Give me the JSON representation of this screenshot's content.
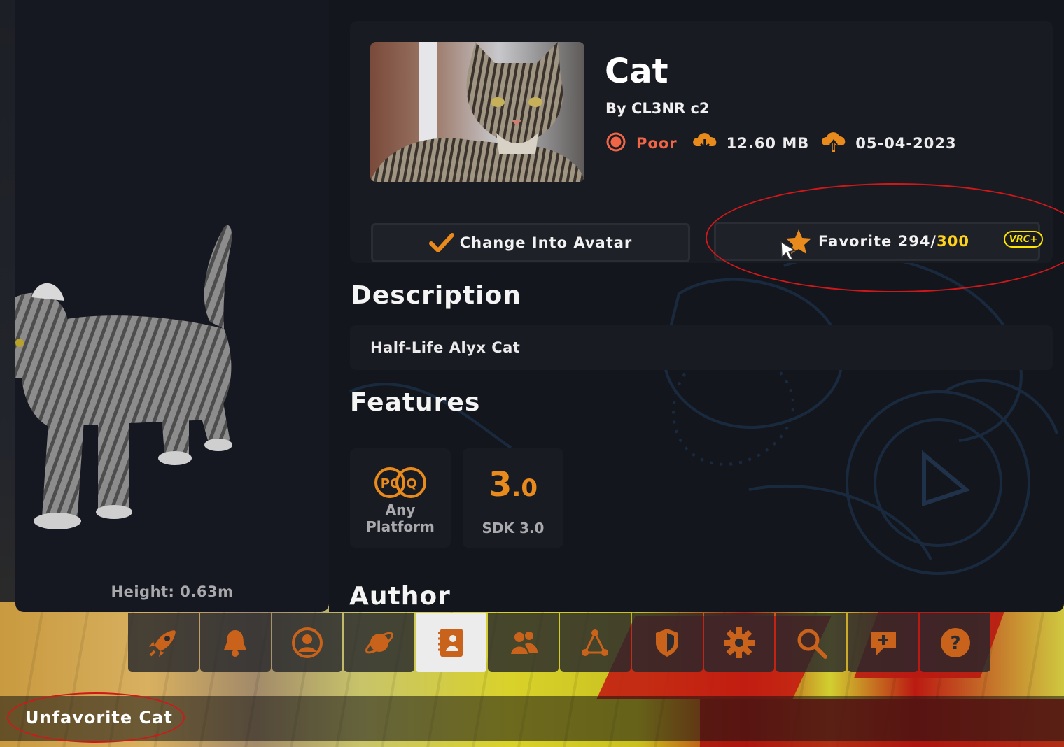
{
  "avatar": {
    "name": "Cat",
    "byline": "By CL3NR c2",
    "performance": "Poor",
    "download_size": "12.60 MB",
    "upload_date": "05-04-2023",
    "height_label": "Height: 0.63m"
  },
  "buttons": {
    "change_label": "Change Into Avatar",
    "favorite_label": "Favorite 294/",
    "favorite_max": "300",
    "vrc_plus_badge": "VRC+"
  },
  "sections": {
    "description_title": "Description",
    "description_text": "Half-Life Alyx Cat",
    "features_title": "Features",
    "author_title": "Author"
  },
  "features": [
    {
      "icon": "pc-quest-icon",
      "label_line1": "Any",
      "label_line2": "Platform"
    },
    {
      "icon": "sdk-version-icon",
      "big_text": "3",
      "big_suffix": ".0",
      "label": "SDK 3.0"
    }
  ],
  "nav": {
    "items": [
      {
        "icon": "rocket-icon",
        "active": false
      },
      {
        "icon": "bell-icon",
        "active": false
      },
      {
        "icon": "profile-icon",
        "active": false
      },
      {
        "icon": "planet-icon",
        "active": false
      },
      {
        "icon": "avatars-icon",
        "active": true
      },
      {
        "icon": "friends-icon",
        "active": false
      },
      {
        "icon": "network-icon",
        "active": false
      },
      {
        "icon": "shield-icon",
        "active": false
      },
      {
        "icon": "gear-icon",
        "active": false
      },
      {
        "icon": "search-icon",
        "active": false
      },
      {
        "icon": "add-chat-icon",
        "active": false
      },
      {
        "icon": "help-icon",
        "active": false
      }
    ]
  },
  "toast": {
    "text": "Unfavorite Cat"
  },
  "colors": {
    "accent": "#e98a1c",
    "performance_poor": "#f06545",
    "vrc_plus": "#ffe600",
    "panel": "#191b23",
    "annotation": "#d01818"
  }
}
